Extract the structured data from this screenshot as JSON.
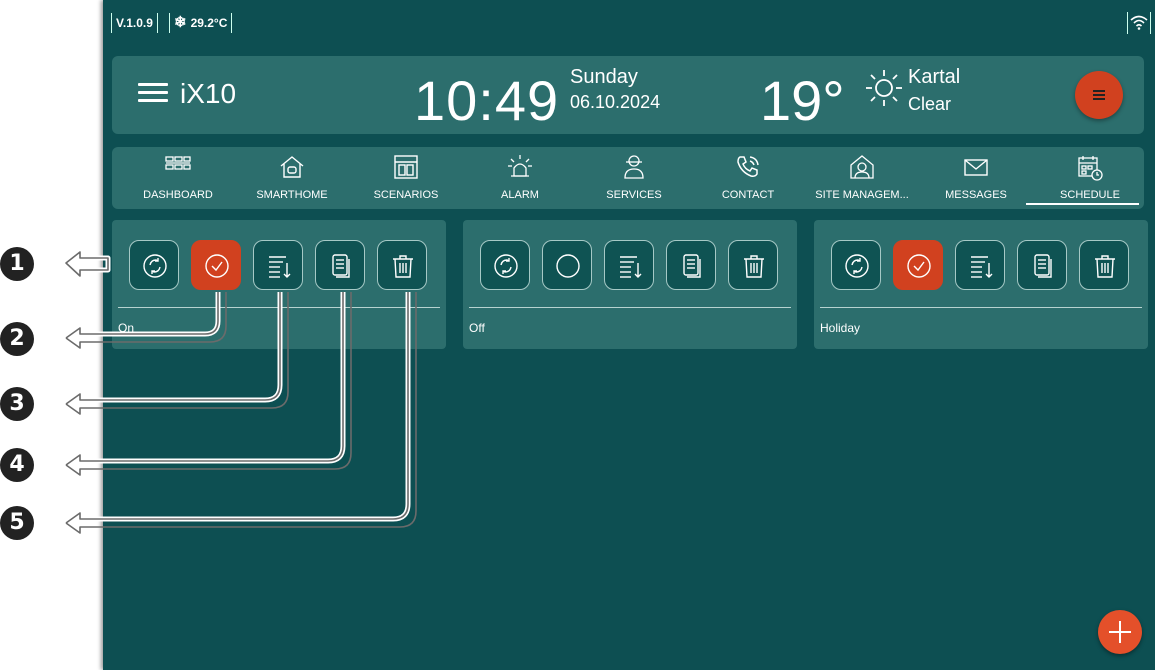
{
  "status": {
    "version": "V.1.0.9",
    "temperature": "29.2°C"
  },
  "header": {
    "title": "iX10",
    "time": "10:49",
    "day": "Sunday",
    "date": "06.10.2024",
    "outside_temp": "19°",
    "city": "Kartal",
    "condition": "Clear"
  },
  "nav": {
    "items": [
      {
        "label": "DASHBOARD",
        "icon": "dashboard-icon"
      },
      {
        "label": "SMARTHOME",
        "icon": "smarthome-icon"
      },
      {
        "label": "SCENARIOS",
        "icon": "scenarios-icon"
      },
      {
        "label": "ALARM",
        "icon": "alarm-icon"
      },
      {
        "label": "SERVICES",
        "icon": "services-icon"
      },
      {
        "label": "CONTACT",
        "icon": "contact-icon"
      },
      {
        "label": "SITE MANAGEM...",
        "icon": "site-management-icon"
      },
      {
        "label": "MESSAGES",
        "icon": "messages-icon"
      },
      {
        "label": "SCHEDULE",
        "icon": "schedule-icon"
      }
    ],
    "active": "SCHEDULE"
  },
  "schedules": [
    {
      "label": "On",
      "status": "selected"
    },
    {
      "label": "Off",
      "status": "unselected"
    },
    {
      "label": "Holiday",
      "status": "selected"
    }
  ],
  "callouts": [
    "1",
    "2",
    "3",
    "4",
    "5"
  ],
  "colors": {
    "background": "#0d4f52",
    "panel": "#2c6e6d",
    "accent": "#d1411f"
  }
}
